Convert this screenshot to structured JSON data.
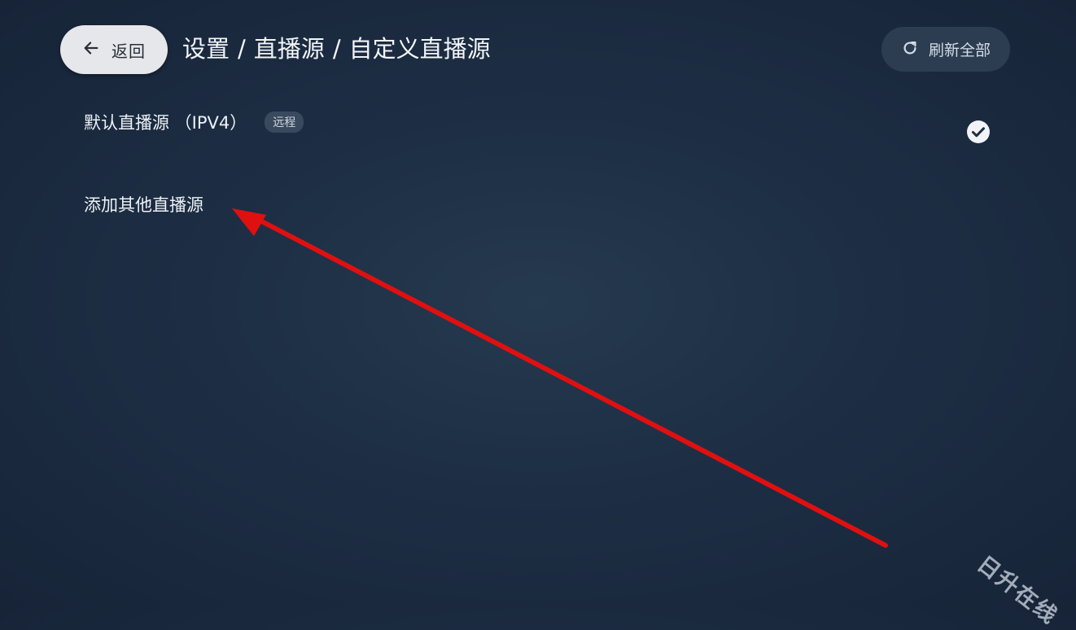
{
  "header": {
    "back_label": "返回",
    "breadcrumb": [
      "设置",
      "直播源",
      "自定义直播源"
    ],
    "separator": "/",
    "refresh_label": "刷新全部"
  },
  "sources": [
    {
      "name": "默认直播源 （IPV4）",
      "badge": "远程",
      "selected": true
    }
  ],
  "add_source_label": "添加其他直播源",
  "annotation": {
    "arrow_color": "#e01010"
  },
  "watermark": "日升在线",
  "icons": [
    "arrow-left-icon",
    "refresh-icon",
    "check-circle-icon"
  ]
}
